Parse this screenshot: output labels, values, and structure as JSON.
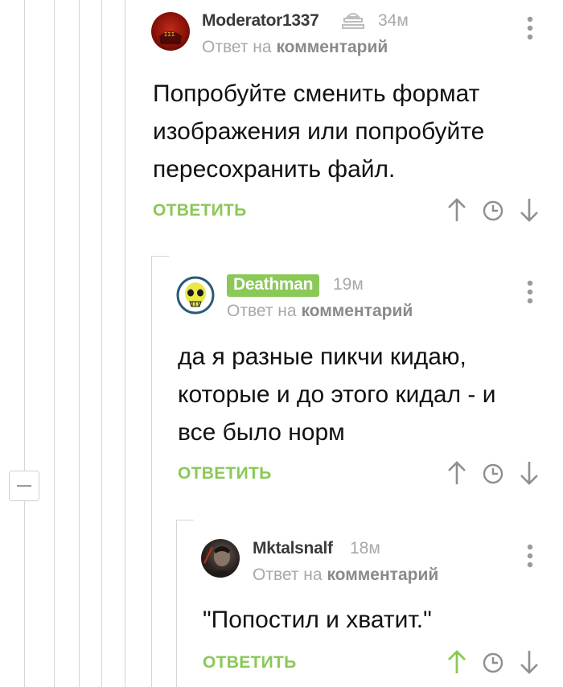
{
  "collapse_icon": "minus-icon",
  "comments": [
    {
      "username": "Moderator1337",
      "time": "34м",
      "reply_prefix": "Ответ на",
      "reply_link": "комментарий",
      "text": "Попробуйте сменить формат изображения или попробуйте пересохранить файл.",
      "reply_label": "ОТВЕТИТЬ",
      "has_moderator_icon": true
    },
    {
      "username": "Deathman",
      "time": "19м",
      "reply_prefix": "Ответ на",
      "reply_link": "комментарий",
      "text": "да я разные пикчи кидаю, которые и до этого кидал - и все было норм",
      "reply_label": "ОТВЕТИТЬ",
      "username_badge_color": "#8ac858"
    },
    {
      "username": "Mktalsnalf",
      "time": "18м",
      "reply_prefix": "Ответ на",
      "reply_link": "комментарий",
      "text": "\"Попостил и хватит.\"",
      "reply_label": "ОТВЕТИТЬ",
      "upvote_active": true
    }
  ],
  "colors": {
    "accent": "#8ac858",
    "muted": "#a8a8a8",
    "icon": "#9a9a9a",
    "thread_line": "#d6d6d6"
  }
}
